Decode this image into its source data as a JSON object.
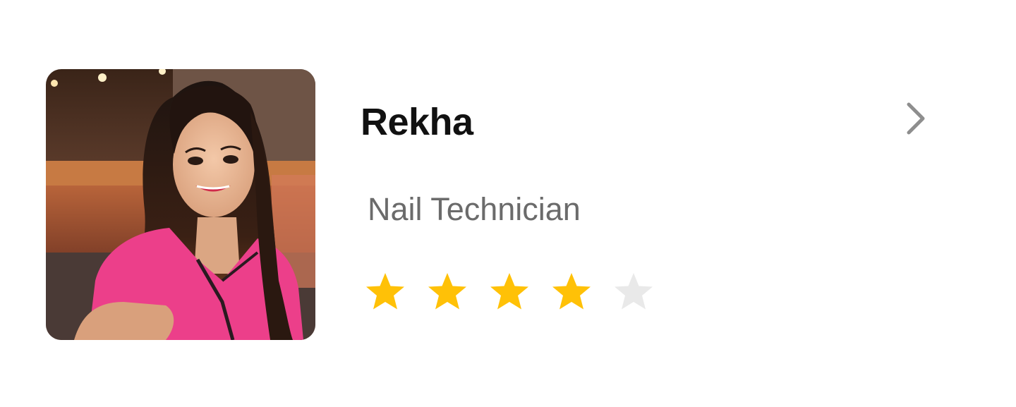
{
  "profile": {
    "name": "Rekha",
    "role": "Nail Technician",
    "rating": 4,
    "rating_max": 5
  },
  "icons": {
    "chevron": "chevron-right-icon",
    "star": "star-icon"
  },
  "colors": {
    "star_filled": "#FFC107",
    "star_empty": "#E9E9E9",
    "name_text": "#111111",
    "role_text": "#6B6B6B",
    "chevron": "#8E8E8E",
    "shirt": "#EC3F8A"
  }
}
